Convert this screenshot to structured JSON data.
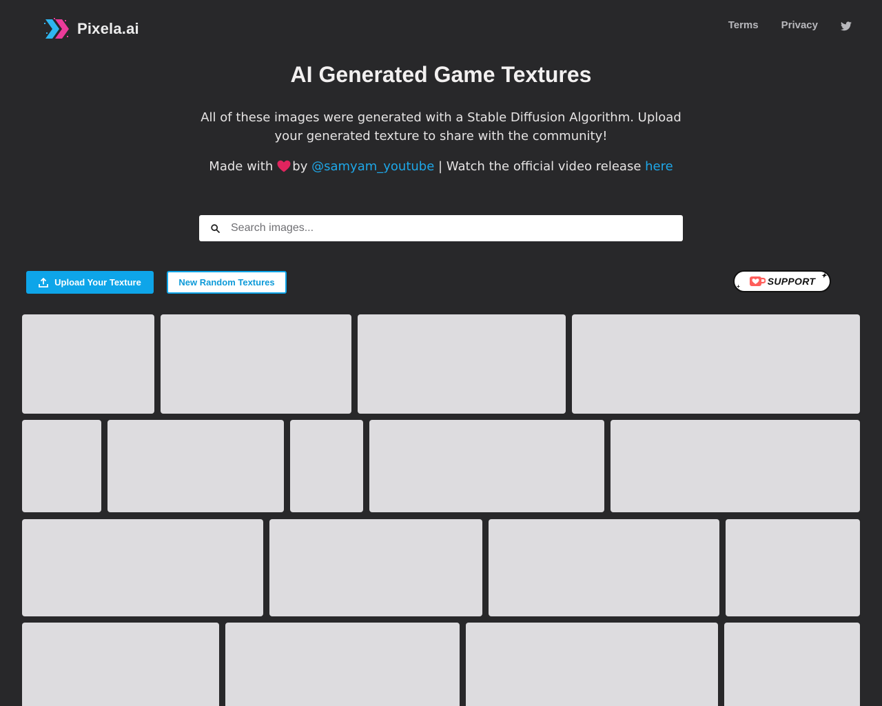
{
  "header": {
    "brand": "Pixela.ai",
    "nav": [
      {
        "label": "Terms"
      },
      {
        "label": "Privacy"
      }
    ]
  },
  "hero": {
    "title": "AI Generated Game Textures",
    "description": "All of these images were generated with a Stable Diffusion Algorithm. Upload your generated texture to share with the community!",
    "made_with": "Made with",
    "by": "by",
    "author": "@samyam_youtube",
    "separator": " | Watch the official video release ",
    "video_link": "here"
  },
  "search": {
    "placeholder": "Search images..."
  },
  "actions": {
    "upload_label": "Upload Your Texture",
    "random_label": "New Random Textures",
    "support_label": "SUPPORT"
  },
  "colors": {
    "background": "#28282a",
    "accent": "#0ea5e9",
    "tile": "#dddcdf",
    "heart": "#e0245e"
  }
}
